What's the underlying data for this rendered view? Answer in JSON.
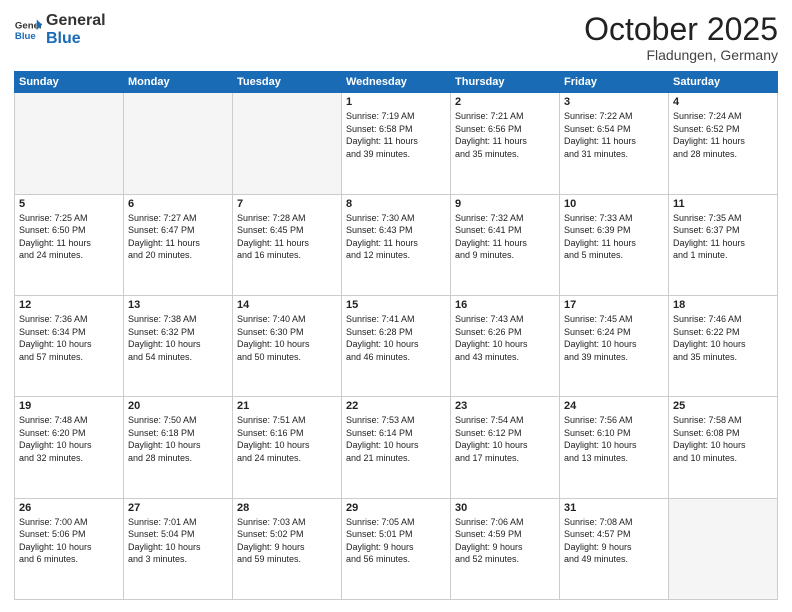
{
  "logo": {
    "line1": "General",
    "line2": "Blue"
  },
  "title": "October 2025",
  "subtitle": "Fladungen, Germany",
  "days": [
    "Sunday",
    "Monday",
    "Tuesday",
    "Wednesday",
    "Thursday",
    "Friday",
    "Saturday"
  ],
  "weeks": [
    [
      {
        "num": "",
        "text": ""
      },
      {
        "num": "",
        "text": ""
      },
      {
        "num": "",
        "text": ""
      },
      {
        "num": "1",
        "text": "Sunrise: 7:19 AM\nSunset: 6:58 PM\nDaylight: 11 hours\nand 39 minutes."
      },
      {
        "num": "2",
        "text": "Sunrise: 7:21 AM\nSunset: 6:56 PM\nDaylight: 11 hours\nand 35 minutes."
      },
      {
        "num": "3",
        "text": "Sunrise: 7:22 AM\nSunset: 6:54 PM\nDaylight: 11 hours\nand 31 minutes."
      },
      {
        "num": "4",
        "text": "Sunrise: 7:24 AM\nSunset: 6:52 PM\nDaylight: 11 hours\nand 28 minutes."
      }
    ],
    [
      {
        "num": "5",
        "text": "Sunrise: 7:25 AM\nSunset: 6:50 PM\nDaylight: 11 hours\nand 24 minutes."
      },
      {
        "num": "6",
        "text": "Sunrise: 7:27 AM\nSunset: 6:47 PM\nDaylight: 11 hours\nand 20 minutes."
      },
      {
        "num": "7",
        "text": "Sunrise: 7:28 AM\nSunset: 6:45 PM\nDaylight: 11 hours\nand 16 minutes."
      },
      {
        "num": "8",
        "text": "Sunrise: 7:30 AM\nSunset: 6:43 PM\nDaylight: 11 hours\nand 12 minutes."
      },
      {
        "num": "9",
        "text": "Sunrise: 7:32 AM\nSunset: 6:41 PM\nDaylight: 11 hours\nand 9 minutes."
      },
      {
        "num": "10",
        "text": "Sunrise: 7:33 AM\nSunset: 6:39 PM\nDaylight: 11 hours\nand 5 minutes."
      },
      {
        "num": "11",
        "text": "Sunrise: 7:35 AM\nSunset: 6:37 PM\nDaylight: 11 hours\nand 1 minute."
      }
    ],
    [
      {
        "num": "12",
        "text": "Sunrise: 7:36 AM\nSunset: 6:34 PM\nDaylight: 10 hours\nand 57 minutes."
      },
      {
        "num": "13",
        "text": "Sunrise: 7:38 AM\nSunset: 6:32 PM\nDaylight: 10 hours\nand 54 minutes."
      },
      {
        "num": "14",
        "text": "Sunrise: 7:40 AM\nSunset: 6:30 PM\nDaylight: 10 hours\nand 50 minutes."
      },
      {
        "num": "15",
        "text": "Sunrise: 7:41 AM\nSunset: 6:28 PM\nDaylight: 10 hours\nand 46 minutes."
      },
      {
        "num": "16",
        "text": "Sunrise: 7:43 AM\nSunset: 6:26 PM\nDaylight: 10 hours\nand 43 minutes."
      },
      {
        "num": "17",
        "text": "Sunrise: 7:45 AM\nSunset: 6:24 PM\nDaylight: 10 hours\nand 39 minutes."
      },
      {
        "num": "18",
        "text": "Sunrise: 7:46 AM\nSunset: 6:22 PM\nDaylight: 10 hours\nand 35 minutes."
      }
    ],
    [
      {
        "num": "19",
        "text": "Sunrise: 7:48 AM\nSunset: 6:20 PM\nDaylight: 10 hours\nand 32 minutes."
      },
      {
        "num": "20",
        "text": "Sunrise: 7:50 AM\nSunset: 6:18 PM\nDaylight: 10 hours\nand 28 minutes."
      },
      {
        "num": "21",
        "text": "Sunrise: 7:51 AM\nSunset: 6:16 PM\nDaylight: 10 hours\nand 24 minutes."
      },
      {
        "num": "22",
        "text": "Sunrise: 7:53 AM\nSunset: 6:14 PM\nDaylight: 10 hours\nand 21 minutes."
      },
      {
        "num": "23",
        "text": "Sunrise: 7:54 AM\nSunset: 6:12 PM\nDaylight: 10 hours\nand 17 minutes."
      },
      {
        "num": "24",
        "text": "Sunrise: 7:56 AM\nSunset: 6:10 PM\nDaylight: 10 hours\nand 13 minutes."
      },
      {
        "num": "25",
        "text": "Sunrise: 7:58 AM\nSunset: 6:08 PM\nDaylight: 10 hours\nand 10 minutes."
      }
    ],
    [
      {
        "num": "26",
        "text": "Sunrise: 7:00 AM\nSunset: 5:06 PM\nDaylight: 10 hours\nand 6 minutes."
      },
      {
        "num": "27",
        "text": "Sunrise: 7:01 AM\nSunset: 5:04 PM\nDaylight: 10 hours\nand 3 minutes."
      },
      {
        "num": "28",
        "text": "Sunrise: 7:03 AM\nSunset: 5:02 PM\nDaylight: 9 hours\nand 59 minutes."
      },
      {
        "num": "29",
        "text": "Sunrise: 7:05 AM\nSunset: 5:01 PM\nDaylight: 9 hours\nand 56 minutes."
      },
      {
        "num": "30",
        "text": "Sunrise: 7:06 AM\nSunset: 4:59 PM\nDaylight: 9 hours\nand 52 minutes."
      },
      {
        "num": "31",
        "text": "Sunrise: 7:08 AM\nSunset: 4:57 PM\nDaylight: 9 hours\nand 49 minutes."
      },
      {
        "num": "",
        "text": ""
      }
    ]
  ]
}
